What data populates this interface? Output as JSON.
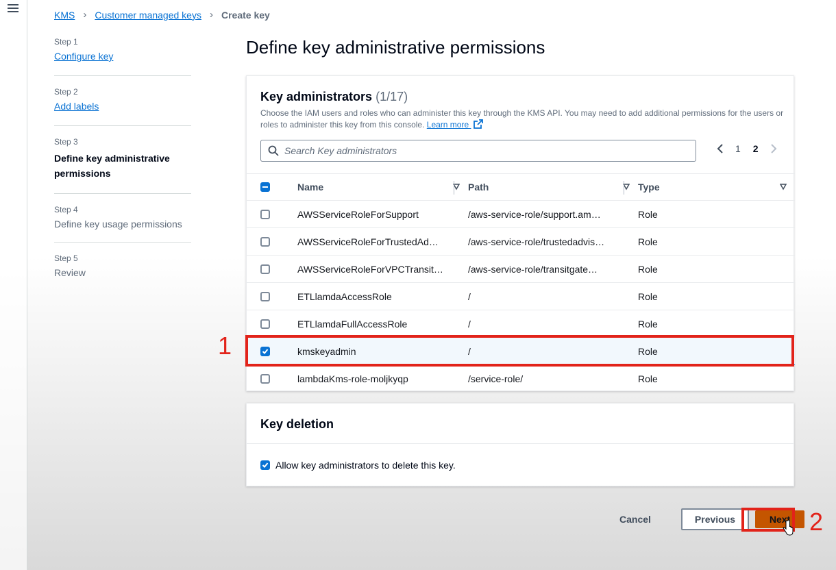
{
  "menu_icon": "hamburger-menu-icon",
  "breadcrumb": {
    "items": [
      "KMS",
      "Customer managed keys"
    ],
    "current": "Create key"
  },
  "steps": [
    {
      "num": "Step 1",
      "label": "Configure key",
      "state": "link"
    },
    {
      "num": "Step 2",
      "label": "Add labels",
      "state": "link"
    },
    {
      "num": "Step 3",
      "label": "Define key administrative permissions",
      "state": "active"
    },
    {
      "num": "Step 4",
      "label": "Define key usage permissions",
      "state": "disabled"
    },
    {
      "num": "Step 5",
      "label": "Review",
      "state": "disabled"
    }
  ],
  "page_title": "Define key administrative permissions",
  "admins": {
    "title": "Key administrators",
    "count": "(1/17)",
    "description": "Choose the IAM users and roles who can administer this key through the KMS API. You may need to add additional permissions for the users or roles to administer this key from this console.",
    "learn_more": "Learn more",
    "search_placeholder": "Search Key administrators",
    "pages": [
      "1",
      "2"
    ],
    "current_page": "2",
    "columns": [
      "Name",
      "Path",
      "Type"
    ],
    "rows": [
      {
        "name": "AWSServiceRoleForSupport",
        "path": "/aws-service-role/support.am…",
        "type": "Role",
        "checked": false
      },
      {
        "name": "AWSServiceRoleForTrustedAd…",
        "path": "/aws-service-role/trustedadvis…",
        "type": "Role",
        "checked": false
      },
      {
        "name": "AWSServiceRoleForVPCTransit…",
        "path": "/aws-service-role/transitgate…",
        "type": "Role",
        "checked": false
      },
      {
        "name": "ETLlamdaAccessRole",
        "path": "/",
        "type": "Role",
        "checked": false
      },
      {
        "name": "ETLlamdaFullAccessRole",
        "path": "/",
        "type": "Role",
        "checked": false
      },
      {
        "name": "kmskeyadmin",
        "path": "/",
        "type": "Role",
        "checked": true
      },
      {
        "name": "lambdaKms-role-moljkyqp",
        "path": "/service-role/",
        "type": "Role",
        "checked": false
      }
    ]
  },
  "deletion": {
    "title": "Key deletion",
    "option_label": "Allow key administrators to delete this key.",
    "checked": true
  },
  "actions": {
    "cancel": "Cancel",
    "previous": "Previous",
    "next": "Next"
  },
  "annotations": {
    "label_1": "1",
    "label_2": "2",
    "color": "#e2231a"
  },
  "colors": {
    "link": "#0972d3",
    "primary_button": "#c45500",
    "selected_row": "#f2f8fd"
  }
}
